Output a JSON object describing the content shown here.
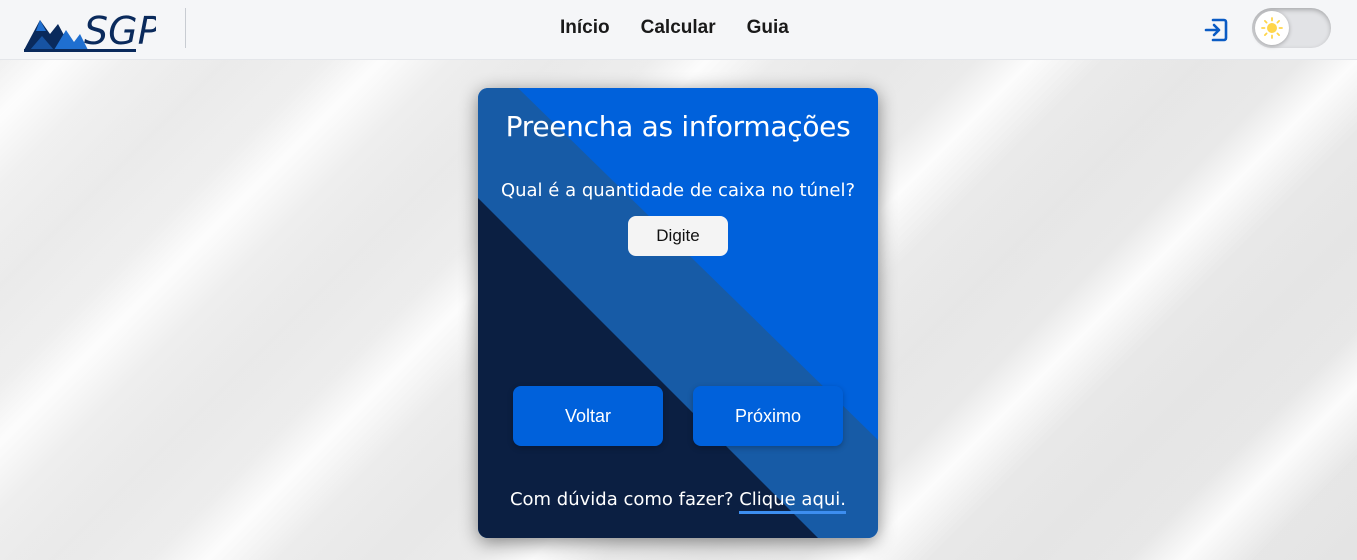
{
  "header": {
    "logo_text": "SGP",
    "nav": {
      "home": "Início",
      "calculate": "Calcular",
      "guide": "Guia"
    },
    "login_icon": "login-icon",
    "theme_toggle": {
      "icon": "sun-icon",
      "state": "light"
    }
  },
  "card": {
    "title": "Preencha as informações",
    "question": "Qual é a quantidade de caixa no túnel?",
    "input": {
      "placeholder": "Digite",
      "value": ""
    },
    "back_button": "Voltar",
    "next_button": "Próximo",
    "help_text": "Com dúvida como fazer?",
    "help_link": "Clique aqui."
  },
  "colors": {
    "primary": "#0061db",
    "card_mid": "#175ba6",
    "card_dark": "#0b1f42",
    "logo_dark": "#0a2a5c",
    "header_bg": "#f5f6f8"
  }
}
